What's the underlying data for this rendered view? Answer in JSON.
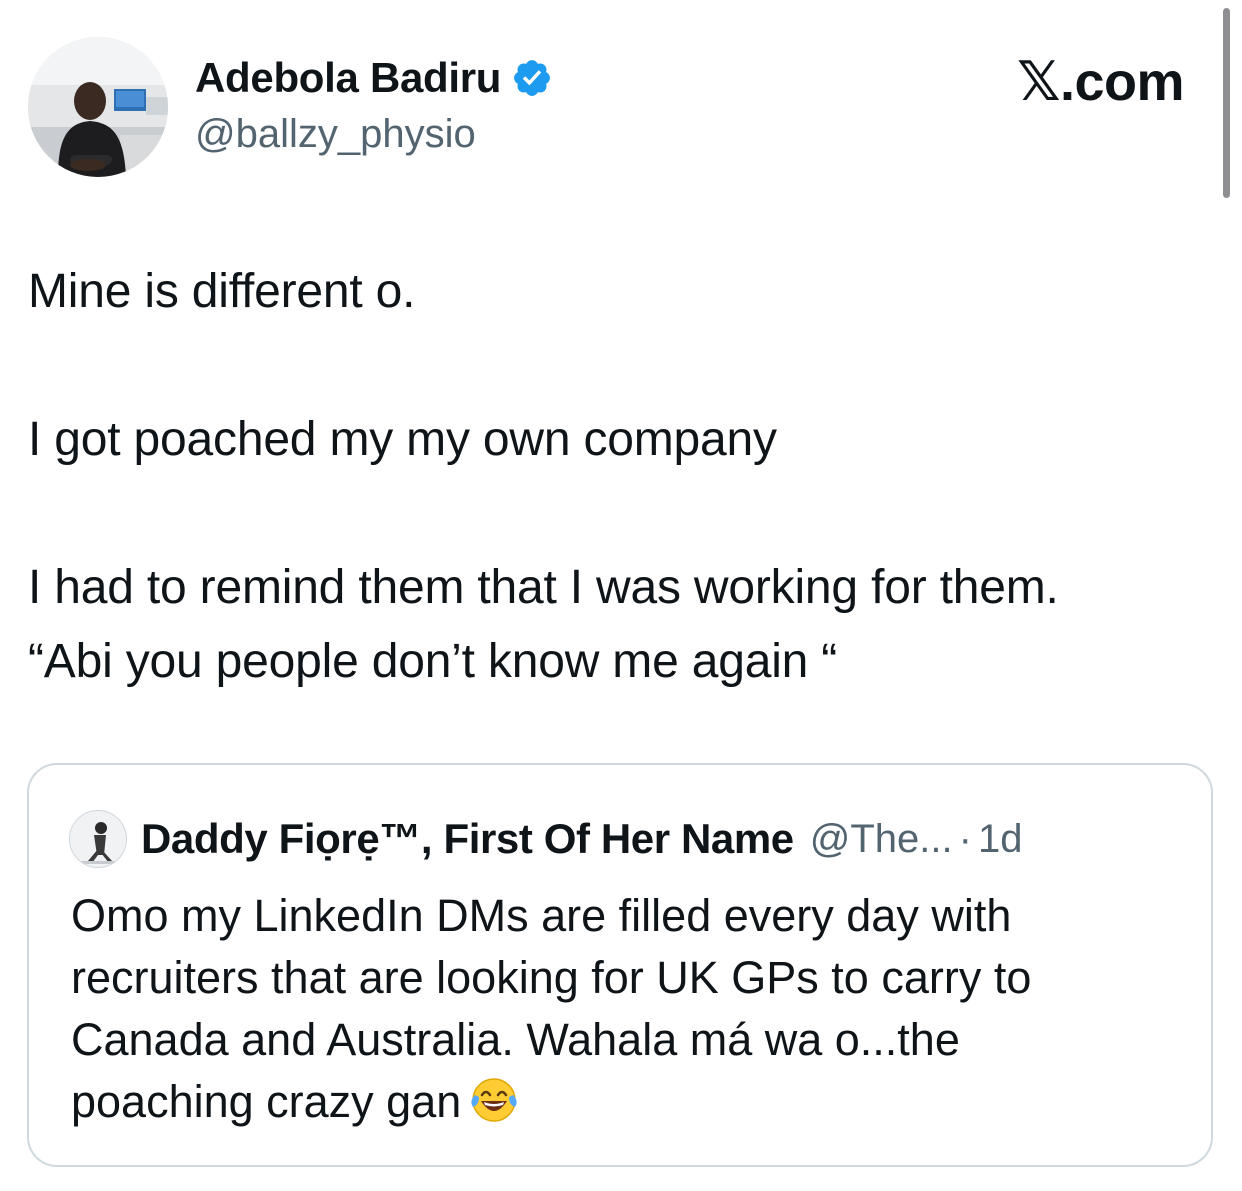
{
  "post": {
    "author": {
      "name": "Adebola Badiru",
      "handle": "@ballzy_physio",
      "verified": true
    },
    "site": "𝕏.com",
    "body": {
      "line1": "Mine is different o.",
      "line2": "I got poached my my own company",
      "line3": "I had to remind them that I was working for them.",
      "line4": "“Abi you people don’t know me again “"
    }
  },
  "quote": {
    "name": "Daddy Fiọrẹ™, First Of Her Name",
    "handle": "@The...",
    "separator": "·",
    "time": "1d",
    "text": {
      "line1": "Omo my LinkedIn DMs are filled every day with",
      "line2": "recruiters that are looking for UK GPs to carry to",
      "line3": "Canada and Australia. Wahala má wa o...the",
      "line4": "poaching crazy gan"
    },
    "emoji": "face-with-tears-of-joy"
  },
  "colors": {
    "text": "#0f1419",
    "secondary": "#536471",
    "verified": "#1d9bf0",
    "border": "#cfd9de"
  }
}
